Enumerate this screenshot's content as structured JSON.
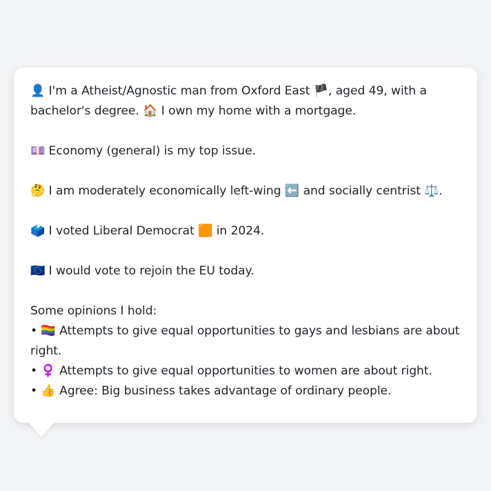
{
  "profile": {
    "intro": {
      "icon": "👤",
      "text1": " I'm a Atheist/Agnostic man from Oxford East ",
      "flag": "🏴",
      "text2": ", aged 49, with a bachelor's degree. ",
      "home_icon": "🏠",
      "text3": " I own my home with a mortgage."
    },
    "issue": {
      "icon": "💷",
      "text": " Economy (general) is my top issue."
    },
    "ideology": {
      "icon": "🤔",
      "text1": " I am moderately economically left-wing ",
      "left_icon": "⬅️",
      "text2": " and socially centrist ",
      "scale_icon": "⚖️",
      "text3": "."
    },
    "vote": {
      "icon": "🗳️",
      "text1": " I voted Liberal Democrat ",
      "party_icon": "🟧",
      "text2": " in 2024."
    },
    "eu": {
      "icon": "🇪🇺",
      "text": " I would vote to rejoin the EU today."
    },
    "opinions_heading": "Some opinions I hold:",
    "opinions": [
      {
        "bullet": "•",
        "icon": "🏳️‍🌈",
        "text": " Attempts to give equal opportunities to gays and lesbians are about right."
      },
      {
        "bullet": "•",
        "icon": "♀️",
        "text": " Attempts to give equal opportunities to women are about right."
      },
      {
        "bullet": "•",
        "icon": "👍",
        "text": " Agree: Big business takes advantage of ordinary people."
      }
    ]
  },
  "colors": {
    "background": "#f2f3f5",
    "bubble": "#ffffff",
    "text": "#1f2328"
  }
}
